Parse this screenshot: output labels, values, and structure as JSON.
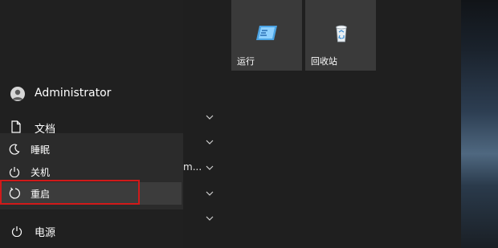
{
  "start_menu": {
    "user": {
      "name": "Administrator"
    },
    "documents": {
      "label": "文档"
    },
    "power": {
      "label": "电源"
    },
    "power_options": [
      {
        "label": "睡眠"
      },
      {
        "label": "关机"
      },
      {
        "label": "重启"
      }
    ],
    "truncated_text": "m..."
  },
  "tiles": [
    {
      "label": "运行",
      "icon": "run-icon"
    },
    {
      "label": "回收站",
      "icon": "recycle-bin-icon"
    }
  ],
  "colors": {
    "highlight_border": "#d11a1a",
    "tile_bg": "#3a3a3a"
  }
}
